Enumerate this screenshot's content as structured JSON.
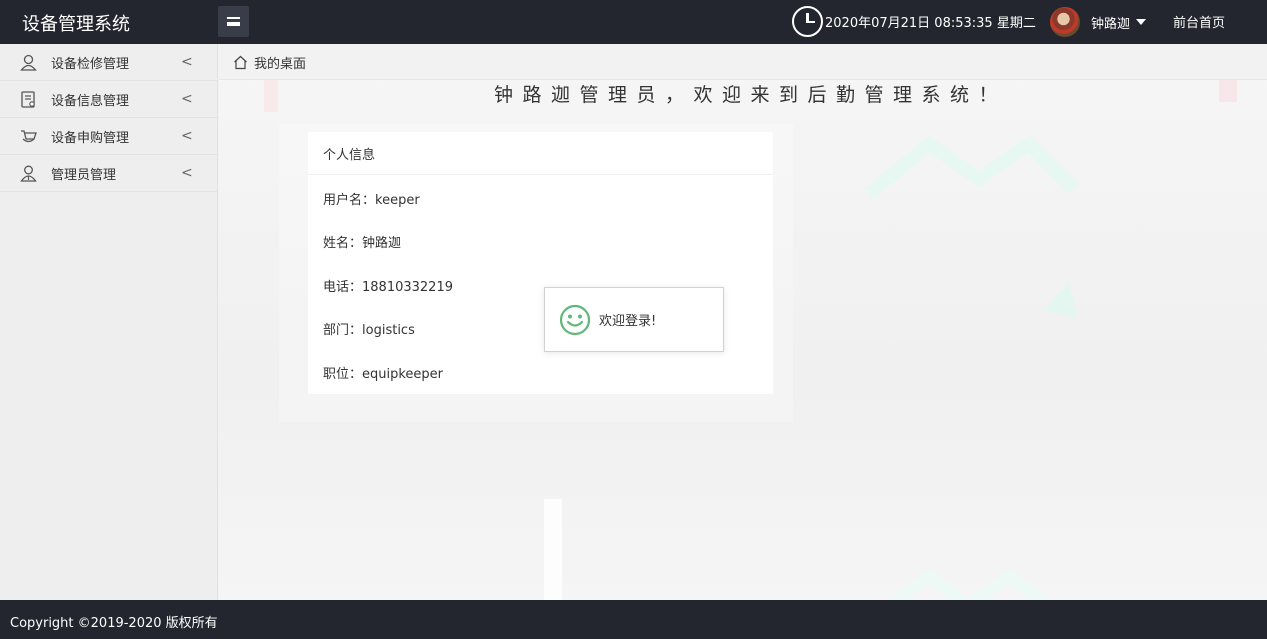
{
  "header": {
    "title": "设备管理系统",
    "datetime": "2020年07月21日 08:53:35 星期二",
    "user_name": "钟路迦",
    "front_link": "前台首页"
  },
  "sidebar": {
    "items": [
      {
        "label": "设备检修管理",
        "icon": "user-icon"
      },
      {
        "label": "设备信息管理",
        "icon": "document-icon"
      },
      {
        "label": "设备申购管理",
        "icon": "cart-icon"
      },
      {
        "label": "管理员管理",
        "icon": "admin-icon"
      }
    ],
    "chevron": "<"
  },
  "tabs": {
    "home_label": "我的桌面"
  },
  "welcome_text": "钟路迦管理员，欢迎来到后勤管理系统！",
  "profile_card": {
    "title": "个人信息",
    "rows": [
      {
        "label": "用户名：",
        "value": "keeper"
      },
      {
        "label": "姓名：",
        "value": "钟路迦"
      },
      {
        "label": "电话：",
        "value": "18810332219"
      },
      {
        "label": "部门：",
        "value": "logistics"
      },
      {
        "label": "职位：",
        "value": "equipkeeper"
      }
    ]
  },
  "toast": {
    "message": "欢迎登录!",
    "icon": "smile-icon"
  },
  "footer": {
    "copyright": "Copyright ©2019-2020 版权所有"
  },
  "colors": {
    "header_bg": "#23262e",
    "toast_icon": "#5fb878"
  }
}
